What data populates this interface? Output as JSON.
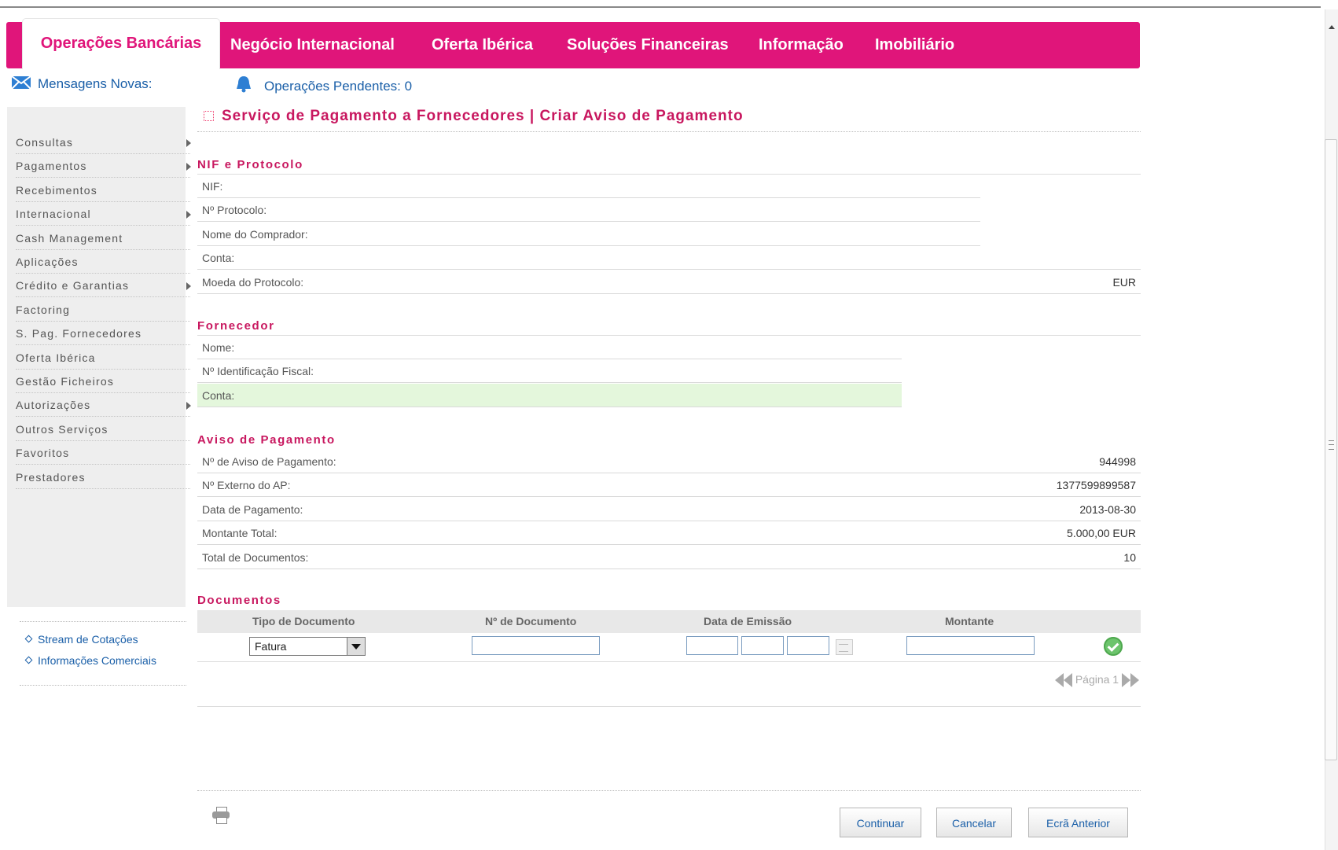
{
  "nav": {
    "active": "Operações Bancárias",
    "items": [
      "Negócio Internacional",
      "Oferta Ibérica",
      "Soluções Financeiras",
      "Informação",
      "Imobiliário"
    ]
  },
  "status": {
    "messages_label": "Mensagens Novas:",
    "pending_label": "Operações Pendentes: 0"
  },
  "sidebar": {
    "items": [
      {
        "label": "Consultas",
        "has_submenu": true
      },
      {
        "label": "Pagamentos",
        "has_submenu": true
      },
      {
        "label": "Recebimentos",
        "has_submenu": false
      },
      {
        "label": "Internacional",
        "has_submenu": true
      },
      {
        "label": "Cash Management",
        "has_submenu": false
      },
      {
        "label": "Aplicações",
        "has_submenu": false
      },
      {
        "label": "Crédito e Garantias",
        "has_submenu": true
      },
      {
        "label": "Factoring",
        "has_submenu": false
      },
      {
        "label": "S. Pag. Fornecedores",
        "has_submenu": false
      },
      {
        "label": "Oferta Ibérica",
        "has_submenu": false
      },
      {
        "label": "Gestão Ficheiros",
        "has_submenu": false
      },
      {
        "label": "Autorizações",
        "has_submenu": true
      },
      {
        "label": "Outros Serviços",
        "has_submenu": false
      },
      {
        "label": "Favoritos",
        "has_submenu": false
      },
      {
        "label": "Prestadores",
        "has_submenu": false
      }
    ],
    "links": [
      "Stream de Cotações",
      "Informações Comerciais"
    ]
  },
  "page": {
    "title": "Serviço de Pagamento a Fornecedores | Criar Aviso de Pagamento"
  },
  "nif_protocolo": {
    "heading": "NIF e Protocolo",
    "rows": [
      {
        "label": "NIF:",
        "value": ""
      },
      {
        "label": "Nº Protocolo:",
        "value": ""
      },
      {
        "label": "Nome do Comprador:",
        "value": ""
      },
      {
        "label": "Conta:",
        "value": ""
      },
      {
        "label": "Moeda do Protocolo:",
        "value": "EUR"
      }
    ]
  },
  "fornecedor": {
    "heading": "Fornecedor",
    "rows": [
      {
        "label": "Nome:",
        "value": ""
      },
      {
        "label": "Nº Identificação Fiscal:",
        "value": ""
      },
      {
        "label": "Conta:",
        "value": ""
      }
    ]
  },
  "aviso": {
    "heading": "Aviso de Pagamento",
    "rows": [
      {
        "label": "Nº de Aviso de Pagamento:",
        "value": "944998"
      },
      {
        "label": "Nº Externo do AP:",
        "value": "1377599899587"
      },
      {
        "label": "Data de Pagamento:",
        "value": "2013-08-30"
      },
      {
        "label": "Montante Total:",
        "value": "5.000,00 EUR"
      },
      {
        "label": "Total de Documentos:",
        "value": "10"
      }
    ]
  },
  "documentos": {
    "heading": "Documentos",
    "columns": [
      "Tipo de Documento",
      "Nº de Documento",
      "Data de Emissão",
      "Montante"
    ],
    "tipo_selected": "Fatura",
    "pager_label": "Página 1"
  },
  "buttons": {
    "continuar": "Continuar",
    "cancelar": "Cancelar",
    "anterior": "Ecrã Anterior"
  },
  "colors": {
    "brand": "#e0157a",
    "heading": "#c8175f",
    "link": "#1a5fa8",
    "highlight_row": "#e4f7dc"
  },
  "icons": {
    "messages": "envelope-icon",
    "pending": "bell-icon",
    "print": "printer-icon",
    "confirm": "check-circle-icon",
    "calendar": "calendar-icon"
  }
}
